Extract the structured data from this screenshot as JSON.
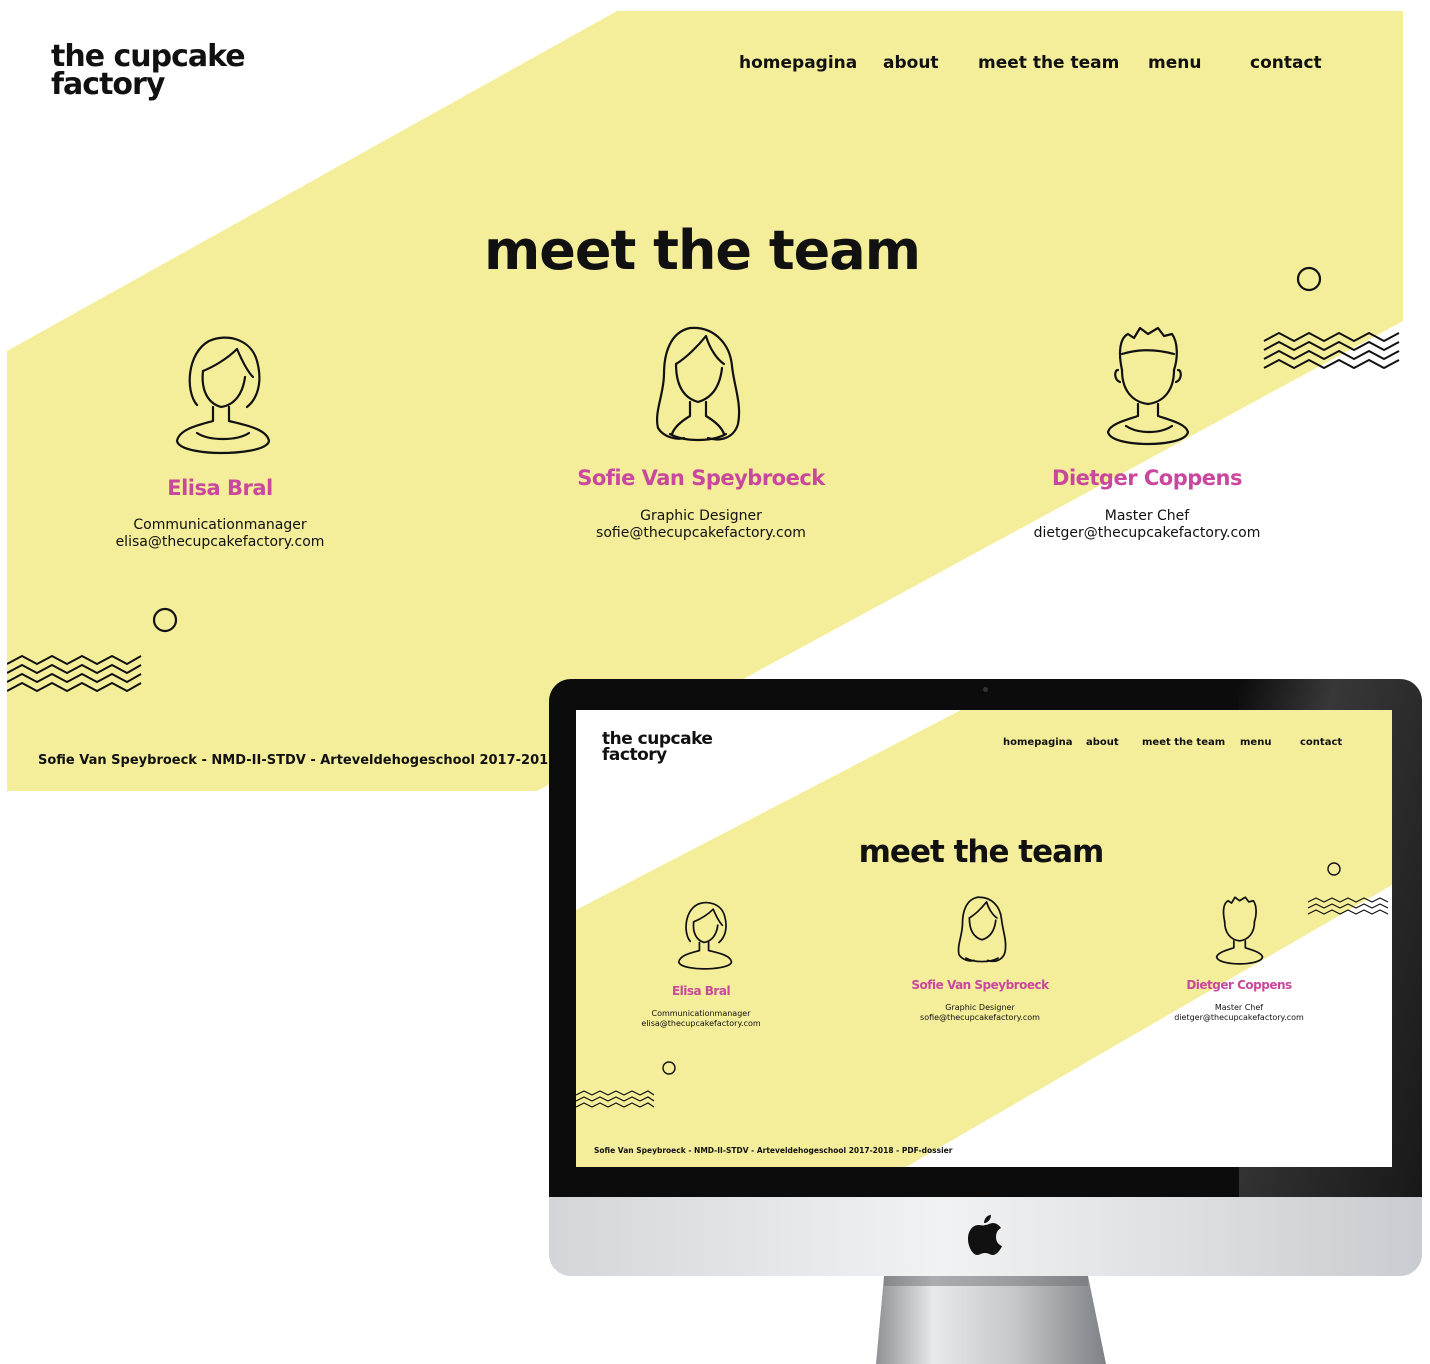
{
  "site": {
    "logo": {
      "line1": "the cupcake",
      "line2": "factory"
    },
    "nav": [
      {
        "label": "homepagina"
      },
      {
        "label": "about"
      },
      {
        "label": "meet the team"
      },
      {
        "label": "menu"
      },
      {
        "label": "contact"
      }
    ],
    "title": "meet the team",
    "team": [
      {
        "name": "Elisa Bral",
        "role": "Communicationmanager",
        "email": "elisa@thecupcakefactory.com",
        "avatar": "woman-short-hair-icon"
      },
      {
        "name": "Sofie Van Speybroeck",
        "role": "Graphic Designer",
        "email": "sofie@thecupcakefactory.com",
        "avatar": "woman-long-hair-icon"
      },
      {
        "name": "Dietger Coppens",
        "role": "Master Chef",
        "email": "dietger@thecupcakefactory.com",
        "avatar": "man-icon"
      }
    ],
    "footer": "Sofie Van Speybroeck - NMD-II-STDV - Arteveldehogeschool 2017-2018 - PDF-dossier"
  },
  "colors": {
    "yellow": "#f4ee9a",
    "accent_pink": "#c9489d",
    "text": "#111111"
  },
  "device": {
    "brand_icon": "apple-logo-icon"
  }
}
